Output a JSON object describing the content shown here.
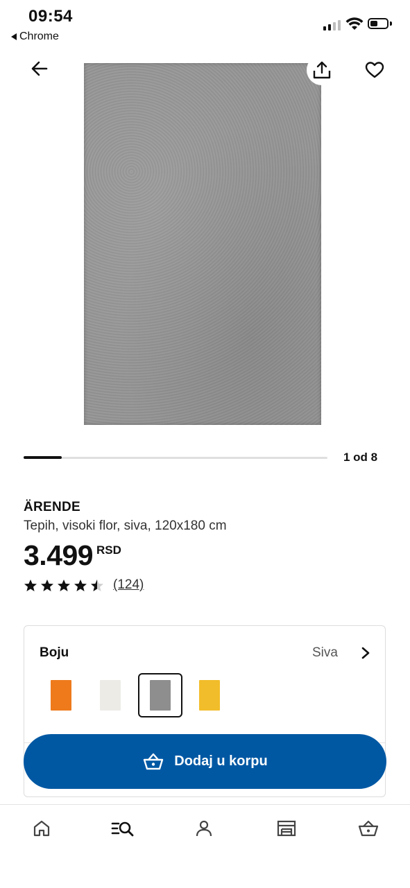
{
  "status_bar": {
    "time": "09:54",
    "back_app": "Chrome"
  },
  "carousel": {
    "counter": "1 od 8",
    "current": 1,
    "total": 8
  },
  "product": {
    "name": "ÄRENDE",
    "description": "Tepih, visoki flor, siva, 120x180 cm",
    "price": "3.499",
    "currency": "RSD",
    "rating": 4.5,
    "reviews": "(124)"
  },
  "color_selector": {
    "label": "Boju",
    "selected": "Siva",
    "swatches": [
      {
        "color": "#ee7a1c",
        "selected": false
      },
      {
        "color": "#ecebe6",
        "selected": false
      },
      {
        "color": "#8e8e8e",
        "selected": true
      },
      {
        "color": "#f2bd2a",
        "selected": false
      }
    ]
  },
  "cart_button": {
    "label": "Dodaj u korpu",
    "color": "#0058a3"
  },
  "bottom_nav": {
    "items": [
      {
        "icon": "home-icon"
      },
      {
        "icon": "search-list-icon",
        "active": true
      },
      {
        "icon": "profile-icon"
      },
      {
        "icon": "store-icon"
      },
      {
        "icon": "cart-icon"
      }
    ]
  },
  "icons": {
    "back": "arrow-left-icon",
    "share": "share-icon",
    "favorite": "heart-icon"
  }
}
